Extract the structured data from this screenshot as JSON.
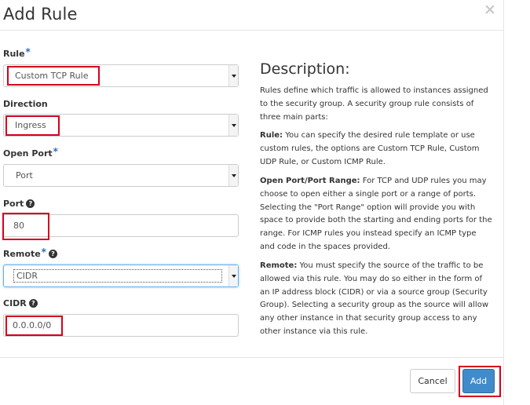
{
  "dialog": {
    "title": "Add Rule",
    "close_symbol": "×"
  },
  "form": {
    "rule": {
      "label": "Rule",
      "required_mark": "*",
      "value": "Custom TCP Rule"
    },
    "direction": {
      "label": "Direction",
      "value": "Ingress"
    },
    "open_port": {
      "label": "Open Port",
      "required_mark": "*",
      "value": "Port"
    },
    "port": {
      "label": "Port",
      "help": "?",
      "value": "80"
    },
    "remote": {
      "label": "Remote",
      "required_mark": "*",
      "help": "?",
      "value": "CIDR"
    },
    "cidr": {
      "label": "CIDR",
      "help": "?",
      "value": "0.0.0.0/0"
    }
  },
  "description": {
    "title": "Description:",
    "intro": "Rules define which traffic is allowed to instances assigned to the security group. A security group rule consists of three main parts:",
    "rule_term": "Rule:",
    "rule_text": " You can specify the desired rule template or use custom rules, the options are Custom TCP Rule, Custom UDP Rule, or Custom ICMP Rule.",
    "port_term": "Open Port/Port Range:",
    "port_text": " For TCP and UDP rules you may choose to open either a single port or a range of ports. Selecting the \"Port Range\" option will provide you with space to provide both the starting and ending ports for the range. For ICMP rules you instead specify an ICMP type and code in the spaces provided.",
    "remote_term": "Remote:",
    "remote_text": " You must specify the source of the traffic to be allowed via this rule. You may do so either in the form of an IP address block (CIDR) or via a source group (Security Group). Selecting a security group as the source will allow any other instance in that security group access to any other instance via this rule."
  },
  "footer": {
    "cancel_label": "Cancel",
    "add_label": "Add"
  },
  "colors": {
    "primary": "#428bca",
    "required": "#2a6ebb",
    "highlight": "#d6001c"
  }
}
